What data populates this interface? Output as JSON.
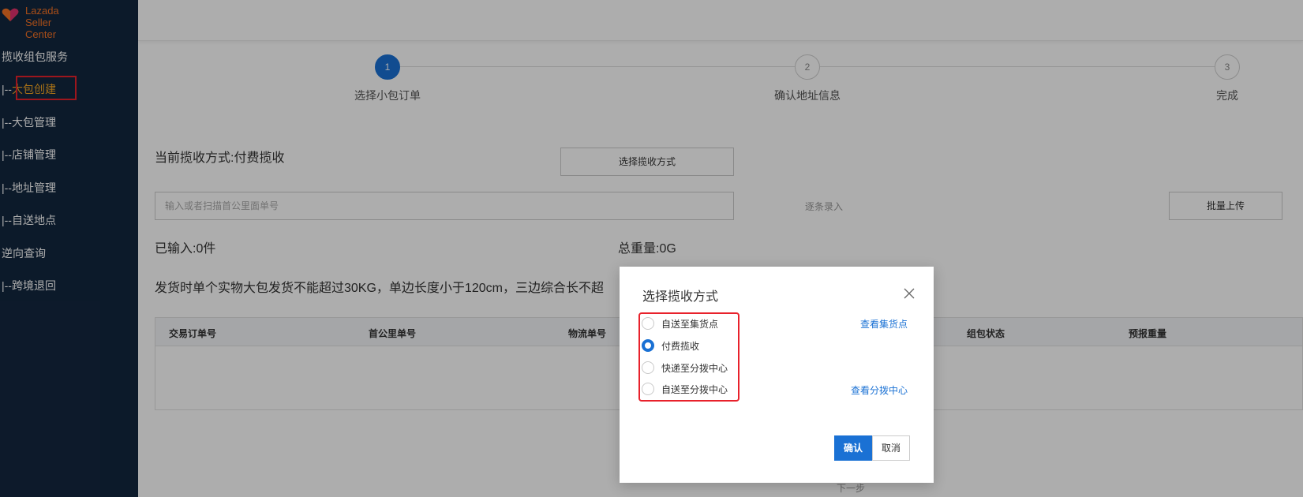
{
  "sidebar": {
    "brand": {
      "line1": "Lazada",
      "line2": "Seller Center"
    },
    "items": [
      {
        "label": "揽收组包服务",
        "prefix": "",
        "active": false
      },
      {
        "label": "大包创建",
        "prefix": "|--",
        "active": true
      },
      {
        "label": "大包管理",
        "prefix": "|--",
        "active": false
      },
      {
        "label": "店铺管理",
        "prefix": "|--",
        "active": false
      },
      {
        "label": "地址管理",
        "prefix": "|--",
        "active": false
      },
      {
        "label": "自送地点",
        "prefix": "|--",
        "active": false
      },
      {
        "label": "逆向查询",
        "prefix": "",
        "active": false
      },
      {
        "label": "跨境退回",
        "prefix": "|--",
        "active": false
      }
    ]
  },
  "steps": [
    {
      "number": "1",
      "label": "选择小包订单",
      "active": true
    },
    {
      "number": "2",
      "label": "确认地址信息",
      "active": false
    },
    {
      "number": "3",
      "label": "完成",
      "active": false
    }
  ],
  "main": {
    "pickup_method_text": "当前揽收方式:付费揽收",
    "choose_pickup_button": "选择揽收方式",
    "scan_input_placeholder": "输入或者扫描首公里面单号",
    "entry_link": "逐条录入",
    "batch_upload_button": "批量上传",
    "entered_count": "已输入:0件",
    "total_weight": "总重量:0G",
    "notice": "发货时单个实物大包发货不能超过30KG，单边长度小于120cm，三边综合长不超",
    "table_headers": [
      "交易订单号",
      "首公里单号",
      "物流单号",
      "",
      "组包状态",
      "预报重量"
    ],
    "next_step": "下一步"
  },
  "modal": {
    "title": "选择揽收方式",
    "options": [
      {
        "label": "自送至集货点",
        "checked": false
      },
      {
        "label": "付费揽收",
        "checked": true
      },
      {
        "label": "快递至分拨中心",
        "checked": false
      },
      {
        "label": "自送至分拨中心",
        "checked": false
      }
    ],
    "links": {
      "view_collection_points": "查看集货点",
      "view_distribution_centers": "查看分拨中心"
    },
    "confirm_button": "确认",
    "cancel_button": "取消"
  },
  "colors": {
    "sidebar_bg": "#13273f",
    "accent_blue": "#1a71d4",
    "active_nav": "#f5a623",
    "highlight_red": "#e8212b",
    "brand_orange": "#f57224"
  }
}
